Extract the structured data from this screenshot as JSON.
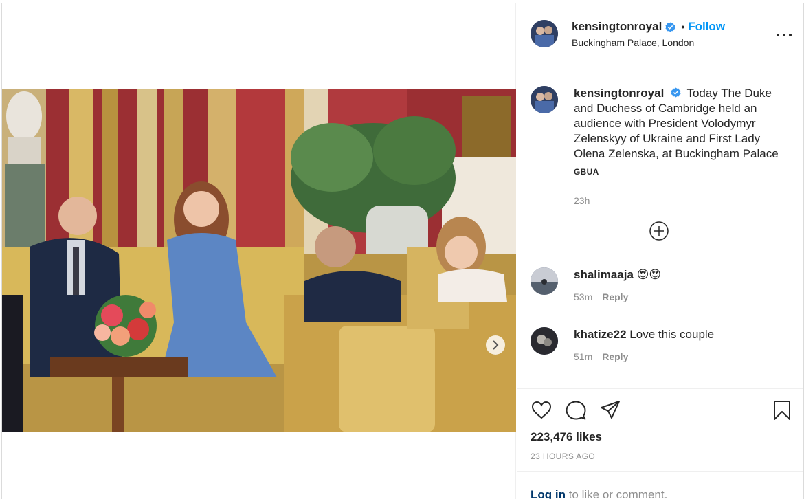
{
  "header": {
    "username": "kensingtonroyal",
    "separator": "•",
    "follow_label": "Follow",
    "location": "Buckingham Palace, London"
  },
  "caption": {
    "username": "kensingtonroyal",
    "text": "Today The Duke and Duchess of Cambridge held an audience with President Volodymyr Zelenskyy of Ukraine and First Lady Olena Zelenska, at Buckingham Palace",
    "tag": "GBUA",
    "time": "23h"
  },
  "comments": [
    {
      "username": "shalimaaja",
      "text": "😍😍",
      "time": "53m",
      "reply_label": "Reply"
    },
    {
      "username": "khatize22",
      "text": "Love this couple",
      "time": "51m",
      "reply_label": "Reply"
    }
  ],
  "actions": {
    "icons": [
      "heart-icon",
      "comment-icon",
      "share-icon",
      "bookmark-icon"
    ],
    "likes": "223,476 likes",
    "timestamp": "23 HOURS AGO"
  },
  "login": {
    "link_label": "Log in",
    "suffix": " to like or comment."
  },
  "colors": {
    "accent": "#0095f6",
    "verified": "#3897f0",
    "muted": "#8e8e8e",
    "text": "#262626",
    "border": "#dbdbdb",
    "link": "#00376b"
  }
}
